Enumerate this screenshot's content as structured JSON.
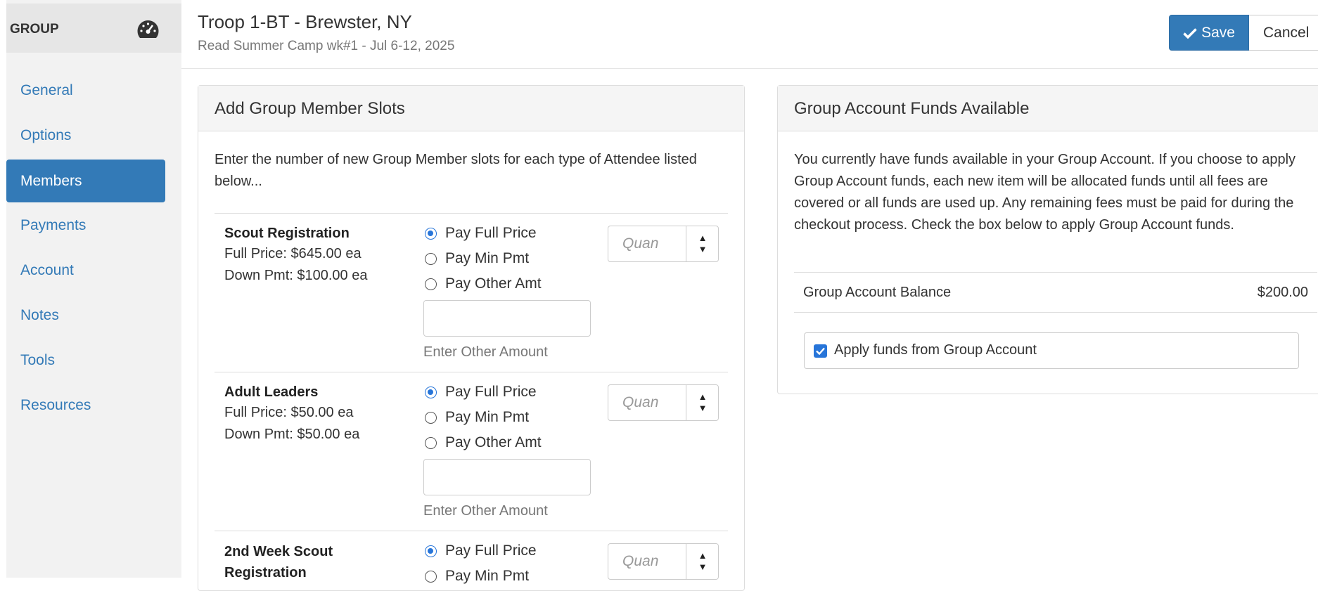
{
  "sidebar": {
    "title": "GROUP",
    "icon": "dashboard-icon",
    "items": [
      {
        "label": "General"
      },
      {
        "label": "Options"
      },
      {
        "label": "Members",
        "active": true
      },
      {
        "label": "Payments"
      },
      {
        "label": "Account"
      },
      {
        "label": "Notes"
      },
      {
        "label": "Tools"
      },
      {
        "label": "Resources"
      }
    ]
  },
  "header": {
    "title": "Troop 1-BT - Brewster, NY",
    "subtitle": "Read Summer Camp wk#1 - Jul 6-12, 2025",
    "save_label": "Save",
    "cancel_label": "Cancel"
  },
  "slots_panel": {
    "heading": "Add Group Member Slots",
    "intro": "Enter the number of new Group Member slots for each type of Attendee listed below...",
    "items": [
      {
        "name": "Scout Registration",
        "full_price": "Full Price: $645.00 ea",
        "down_pmt": "Down Pmt: $100.00 ea",
        "options": [
          "Pay Full Price",
          "Pay Min Pmt",
          "Pay Other Amt"
        ],
        "selected": "Pay Full Price",
        "other_amount_value": "",
        "other_amount_help": "Enter Other Amount",
        "quantity_placeholder": "Quan"
      },
      {
        "name": "Adult Leaders",
        "full_price": "Full Price: $50.00 ea",
        "down_pmt": "Down Pmt: $50.00 ea",
        "options": [
          "Pay Full Price",
          "Pay Min Pmt",
          "Pay Other Amt"
        ],
        "selected": "Pay Full Price",
        "other_amount_value": "",
        "other_amount_help": "Enter Other Amount",
        "quantity_placeholder": "Quan"
      },
      {
        "name": "2nd Week Scout Registration",
        "options": [
          "Pay Full Price",
          "Pay Min Pmt"
        ],
        "selected": "Pay Full Price",
        "quantity_placeholder": "Quan"
      }
    ]
  },
  "funds_panel": {
    "heading": "Group Account Funds Available",
    "text": "You currently have funds available in your Group Account. If you choose to apply Group Account funds, each new item will be allocated funds until all fees are covered or all funds are used up. Any remaining fees must be paid for during the checkout process. Check the box below to apply Group Account funds.",
    "balance_label": "Group Account Balance",
    "balance_value": "$200.00",
    "apply_label": "Apply funds from Group Account",
    "apply_checked": true
  },
  "colors": {
    "primary": "#337ab7",
    "radio_checked": "#2775d9"
  }
}
